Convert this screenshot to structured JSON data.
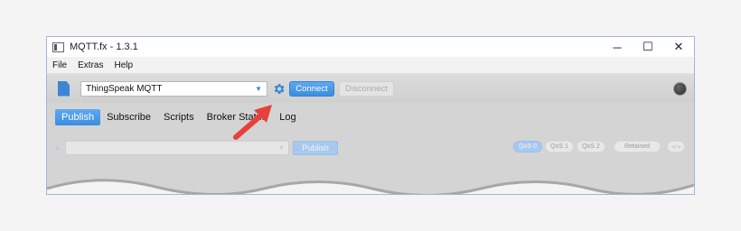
{
  "window": {
    "title": "MQTT.fx - 1.3.1",
    "controls": [
      "─",
      "☐",
      "✕"
    ]
  },
  "menu": [
    "File",
    "Extras",
    "Help"
  ],
  "toolbar": {
    "profile": "ThingSpeak MQTT",
    "connect_label": "Connect",
    "disconnect_label": "Disconnect"
  },
  "tabs": [
    "Publish",
    "Subscribe",
    "Scripts",
    "Broker Status",
    "Log"
  ],
  "publish": {
    "publish_label": "Publish",
    "qos": [
      "QoS 0",
      "QoS 1",
      "QoS 2"
    ],
    "retained_label": "Retained",
    "extra_label": "≪▾"
  },
  "colors": {
    "accent": "#3b8de0",
    "arrow": "#e8403a"
  }
}
